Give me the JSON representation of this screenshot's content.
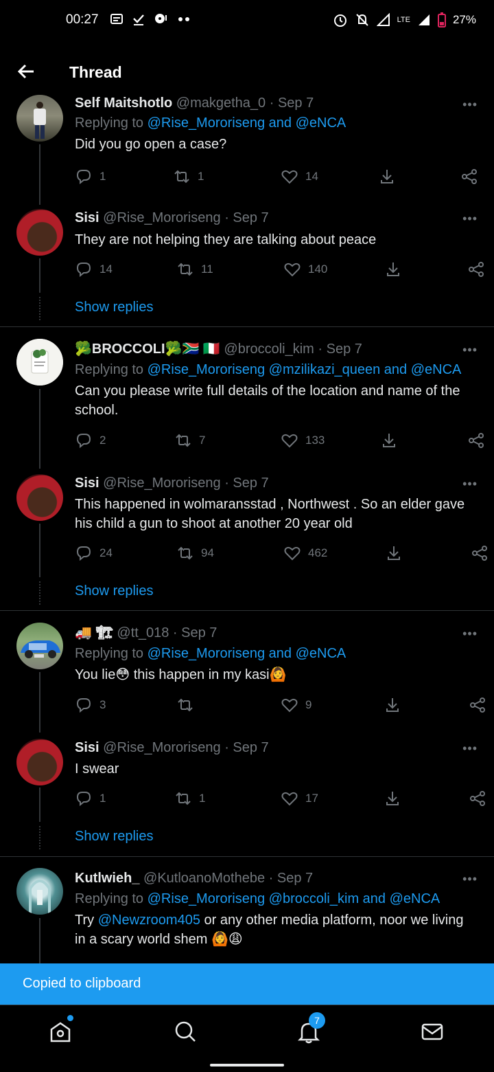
{
  "status_bar": {
    "time": "00:27",
    "network": "LTE",
    "battery": "27%"
  },
  "header": {
    "title": "Thread"
  },
  "tweets": [
    {
      "name": "Self Maitshotlo",
      "handle": "@makgetha_0",
      "date": "· Sep 7",
      "replying_prefix": "Replying to",
      "replying_to": "@Rise_Mororiseng and @eNCA",
      "text": "Did you go open a case?",
      "replies": "1",
      "retweets": "1",
      "likes": "14"
    },
    {
      "name": "Sisi",
      "handle": "@Rise_Mororiseng",
      "date": "· Sep 7",
      "text": "They are not helping they are talking about peace",
      "replies": "14",
      "retweets": "11",
      "likes": "140"
    },
    {
      "name": "🥦BROCCOLI🥦🇿🇦 🇮🇹",
      "handle": "@broccoli_kim",
      "date": "· Sep 7",
      "replying_prefix": "Replying to",
      "replying_to": "@Rise_Mororiseng @mzilikazi_queen and @eNCA",
      "text": "Can you please write full details of the location and name of the school.",
      "replies": "2",
      "retweets": "7",
      "likes": "133"
    },
    {
      "name": "Sisi",
      "handle": "@Rise_Mororiseng",
      "date": "· Sep 7",
      "text": "This happened in wolmaransstad , Northwest .   So an elder gave his child a gun to shoot at another 20 year old",
      "replies": "24",
      "retweets": "94",
      "likes": "462"
    },
    {
      "name": "🚚 🏗",
      "handle": "@tt_018",
      "date": "· Sep 7",
      "replying_prefix": "Replying to",
      "replying_to": "@Rise_Mororiseng and @eNCA",
      "text": "You lie😳 this happen in my kasi🙆",
      "replies": "3",
      "retweets": "",
      "likes": "9"
    },
    {
      "name": "Sisi",
      "handle": "@Rise_Mororiseng",
      "date": "· Sep 7",
      "text": "I swear",
      "replies": "1",
      "retweets": "1",
      "likes": "17"
    },
    {
      "name": "Kutlwieh_",
      "handle": "@KutloanoMothebe",
      "date": "· Sep 7",
      "replying_prefix": "Replying to",
      "replying_to": "@Rise_Mororiseng @broccoli_kim and @eNCA",
      "text_prefix": "Try",
      "text_mention": "@Newzroom405",
      "text_suffix": "or any other media platform, noor we living in a scary world shem 🙆😩"
    }
  ],
  "show_replies_label": "Show replies",
  "toast": {
    "text": "Copied to clipboard"
  },
  "nav": {
    "notifications_badge": "7"
  },
  "more_glyph": "•••",
  "colors": {
    "accent": "#1d9bf0",
    "background": "#000000",
    "muted": "#71767b"
  }
}
